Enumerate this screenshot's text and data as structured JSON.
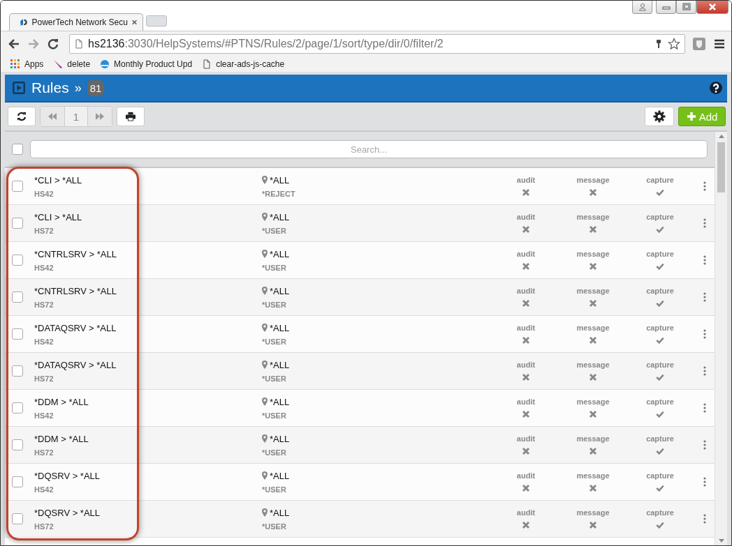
{
  "browser": {
    "tab_title": "PowerTech Network Secu",
    "url_host": "hs2136",
    "url_path": ":3030/HelpSystems/#PTNS/Rules/2/page/1/sort/type/dir/0/filter/2",
    "bookmarks": [
      {
        "label": "Apps"
      },
      {
        "label": "delete"
      },
      {
        "label": "Monthly Product Upd"
      },
      {
        "label": "clear-ads-js-cache"
      }
    ]
  },
  "header": {
    "title": "Rules",
    "separator": "»",
    "count": "81"
  },
  "toolbar": {
    "page": "1",
    "add_label": "Add"
  },
  "search": {
    "placeholder": "Search...",
    "checked": false
  },
  "rows": [
    {
      "name": "*CLI > *ALL",
      "server": "HS42",
      "location": "*ALL",
      "action": "*REJECT",
      "checked": false,
      "flags": [
        {
          "label": "audit",
          "on": false
        },
        {
          "label": "message",
          "on": false
        },
        {
          "label": "capture",
          "on": true
        }
      ]
    },
    {
      "name": "*CLI > *ALL",
      "server": "HS72",
      "location": "*ALL",
      "action": "*USER",
      "checked": false,
      "flags": [
        {
          "label": "audit",
          "on": false
        },
        {
          "label": "message",
          "on": false
        },
        {
          "label": "capture",
          "on": true
        }
      ]
    },
    {
      "name": "*CNTRLSRV > *ALL",
      "server": "HS42",
      "location": "*ALL",
      "action": "*USER",
      "checked": false,
      "flags": [
        {
          "label": "audit",
          "on": false
        },
        {
          "label": "message",
          "on": false
        },
        {
          "label": "capture",
          "on": true
        }
      ]
    },
    {
      "name": "*CNTRLSRV > *ALL",
      "server": "HS72",
      "location": "*ALL",
      "action": "*USER",
      "checked": false,
      "flags": [
        {
          "label": "audit",
          "on": false
        },
        {
          "label": "message",
          "on": false
        },
        {
          "label": "capture",
          "on": true
        }
      ]
    },
    {
      "name": "*DATAQSRV > *ALL",
      "server": "HS42",
      "location": "*ALL",
      "action": "*USER",
      "checked": false,
      "flags": [
        {
          "label": "audit",
          "on": false
        },
        {
          "label": "message",
          "on": false
        },
        {
          "label": "capture",
          "on": true
        }
      ]
    },
    {
      "name": "*DATAQSRV > *ALL",
      "server": "HS72",
      "location": "*ALL",
      "action": "*USER",
      "checked": false,
      "flags": [
        {
          "label": "audit",
          "on": false
        },
        {
          "label": "message",
          "on": false
        },
        {
          "label": "capture",
          "on": true
        }
      ]
    },
    {
      "name": "*DDM > *ALL",
      "server": "HS42",
      "location": "*ALL",
      "action": "*USER",
      "checked": false,
      "flags": [
        {
          "label": "audit",
          "on": false
        },
        {
          "label": "message",
          "on": false
        },
        {
          "label": "capture",
          "on": true
        }
      ]
    },
    {
      "name": "*DDM > *ALL",
      "server": "HS72",
      "location": "*ALL",
      "action": "*USER",
      "checked": false,
      "flags": [
        {
          "label": "audit",
          "on": false
        },
        {
          "label": "message",
          "on": false
        },
        {
          "label": "capture",
          "on": true
        }
      ]
    },
    {
      "name": "*DQSRV > *ALL",
      "server": "HS42",
      "location": "*ALL",
      "action": "*USER",
      "checked": false,
      "flags": [
        {
          "label": "audit",
          "on": false
        },
        {
          "label": "message",
          "on": false
        },
        {
          "label": "capture",
          "on": true
        }
      ]
    },
    {
      "name": "*DQSRV > *ALL",
      "server": "HS72",
      "location": "*ALL",
      "action": "*USER",
      "checked": false,
      "flags": [
        {
          "label": "audit",
          "on": false
        },
        {
          "label": "message",
          "on": false
        },
        {
          "label": "capture",
          "on": true
        }
      ]
    }
  ]
}
